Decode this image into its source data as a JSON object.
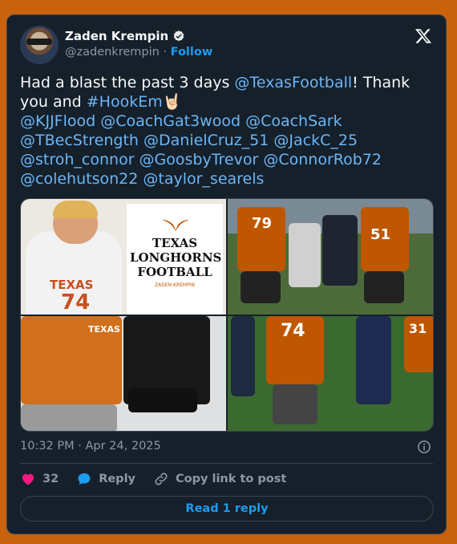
{
  "author": {
    "name": "Zaden Krempin",
    "handle": "@zadenkrempin",
    "separator": "·",
    "follow_label": "Follow"
  },
  "tweet": {
    "text_line1_a": "Had a blast the past 3 days ",
    "mention_texasfootball": "@TexasFootball",
    "text_line1_b": "! Thank you and ",
    "hashtag": "#HookEm",
    "emoji": "🤘🏻",
    "mentions": [
      "@KJJFlood",
      "@CoachGat3wood",
      "@CoachSark",
      "@TBecStrength",
      "@DanielCruz_51",
      "@JackC_25",
      "@stroh_connor",
      "@GoosbyTrevor",
      "@ConnorRob72",
      "@colehutson22",
      "@taylor_searels"
    ]
  },
  "media": {
    "poster_title": "TEXAS LONGHORNS FOOTBALL",
    "poster_subtitle": "ZADEN KREMPIN",
    "jersey_text": "TEXAS",
    "jersey_numbers": [
      "74",
      "79",
      "51",
      "74",
      "31"
    ],
    "shirt_text": "TEXAS"
  },
  "timestamp": "10:32 PM · Apr 24, 2025",
  "actions": {
    "like_count": "32",
    "reply_label": "Reply",
    "copy_link_label": "Copy link to post"
  },
  "read_reply_label": "Read 1 reply",
  "colors": {
    "background": "#c8620c",
    "card": "#15202b",
    "link": "#1d9bf0",
    "like": "#f91880"
  }
}
